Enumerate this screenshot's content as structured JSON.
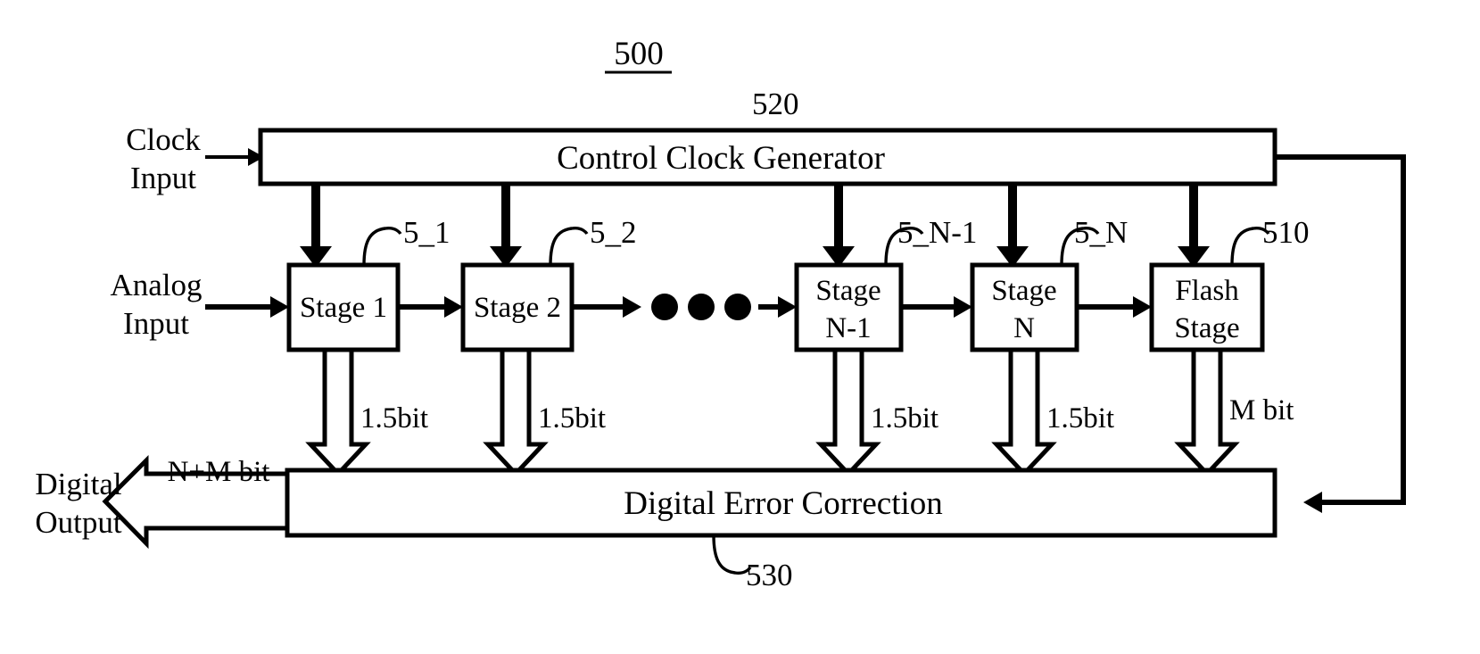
{
  "figure": {
    "number": "500",
    "type": "patent-block-diagram",
    "description": "Pipelined analog-to-digital converter block diagram"
  },
  "inputs": [
    {
      "id": "clock-input",
      "line1": "Clock",
      "line2": "Input"
    },
    {
      "id": "analog-input",
      "line1": "Analog",
      "line2": "Input"
    }
  ],
  "outputs": [
    {
      "id": "digital-output",
      "line1": "Digital",
      "line2": "Output",
      "bus_label": "N+M bit"
    }
  ],
  "blocks": {
    "clock_generator": {
      "label": "Control Clock Generator",
      "ref": "520"
    },
    "error_correction": {
      "label": "Digital Error Correction",
      "ref": "530"
    },
    "flash_stage": {
      "line1": "Flash",
      "line2": "Stage",
      "ref": "510"
    }
  },
  "stages": [
    {
      "line1": "Stage  1",
      "line2": "",
      "ref": "5_1",
      "bits": "1.5bit"
    },
    {
      "line1": "Stage 2",
      "line2": "",
      "ref": "5_2",
      "bits": "1.5bit"
    },
    {
      "line1": "Stage",
      "line2": "N-1",
      "ref": "5_N-1",
      "bits": "1.5bit"
    },
    {
      "line1": "Stage",
      "line2": "N",
      "ref": "5_N",
      "bits": "1.5bit"
    }
  ],
  "flash_bits": "M bit",
  "ellipsis": "• • •",
  "colors": {
    "ink": "#000000",
    "paper": "#ffffff"
  }
}
